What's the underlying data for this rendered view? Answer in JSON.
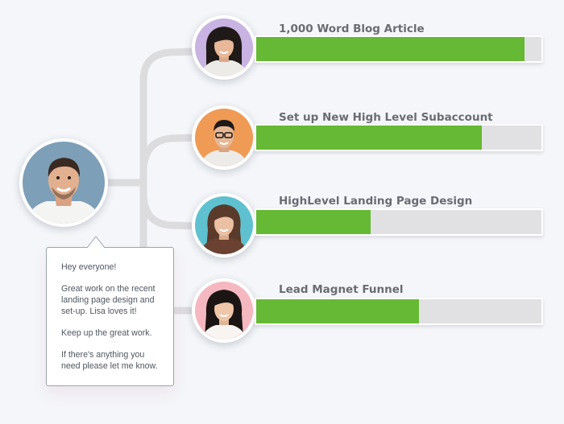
{
  "manager": {
    "avatar_icon": "manager-avatar-icon",
    "message": {
      "greeting": "Hey everyone!",
      "body_lines": [
        "Great work on the recent",
        "landing page design and",
        "set-up. Lisa loves it!"
      ],
      "encouragement": "Keep up the great work.",
      "help_lines": [
        "If there's anything you",
        "need please let me know."
      ]
    }
  },
  "tasks": [
    {
      "title": "1,000 Word Blog Article",
      "progress_percent": 94,
      "assignee_icon": "assignee-avatar-icon",
      "avatar_bg": "#c9b3e2"
    },
    {
      "title": "Set up New High Level Subaccount",
      "progress_percent": 79,
      "assignee_icon": "assignee-avatar-icon",
      "avatar_bg": "#ef9a55"
    },
    {
      "title": "HighLevel Landing Page Design",
      "progress_percent": 40,
      "assignee_icon": "assignee-avatar-icon",
      "avatar_bg": "#5fc1d0"
    },
    {
      "title": "Lead Magnet Funnel",
      "progress_percent": 57,
      "assignee_icon": "assignee-avatar-icon",
      "avatar_bg": "#f6b8c0"
    }
  ],
  "colors": {
    "progress_fill": "#66b934",
    "progress_track": "#e1e1e3",
    "connector": "#dcdcdf",
    "manager_avatar_bg": "#7d9fb8"
  }
}
